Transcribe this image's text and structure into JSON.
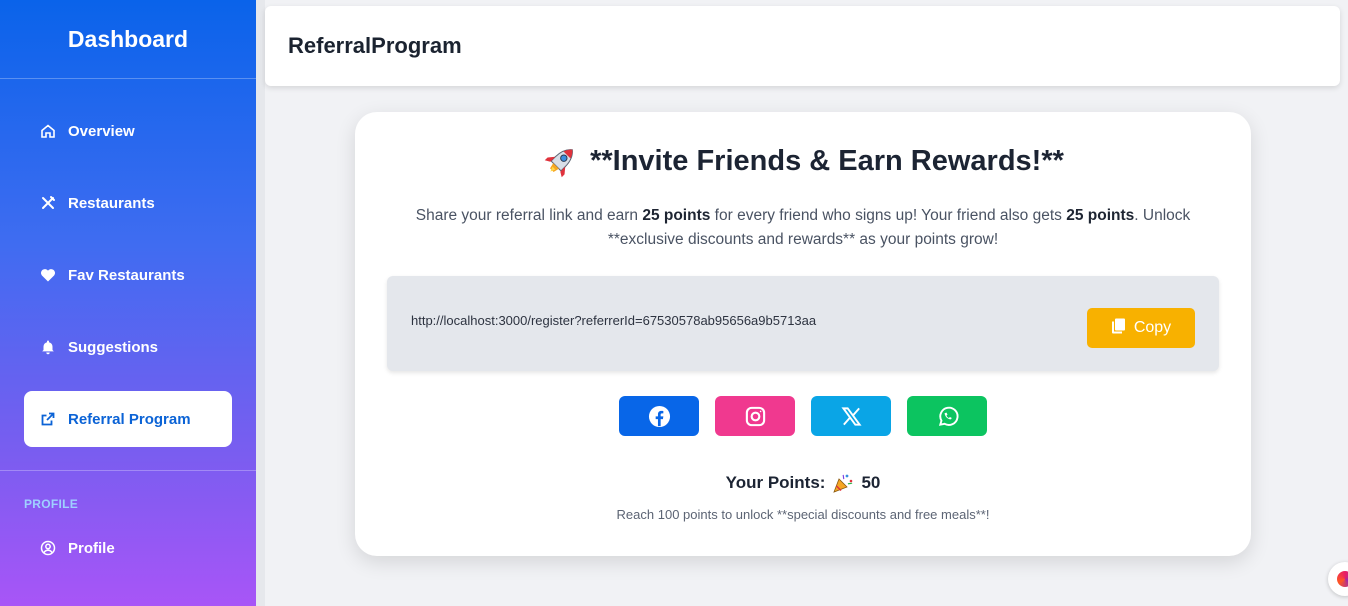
{
  "sidebar": {
    "title": "Dashboard",
    "items": [
      {
        "label": "Overview",
        "icon": "home-icon"
      },
      {
        "label": "Restaurants",
        "icon": "utensils-icon"
      },
      {
        "label": "Fav Restaurants",
        "icon": "heart-icon"
      },
      {
        "label": "Suggestions",
        "icon": "bell-icon"
      },
      {
        "label": "Referral Program",
        "icon": "share-icon",
        "active": true
      }
    ],
    "section_label": "PROFILE",
    "profile_item": {
      "label": "Profile",
      "icon": "user-circle-icon"
    }
  },
  "header": {
    "title": "ReferralProgram"
  },
  "card": {
    "title": "**Invite Friends & Earn Rewards!**",
    "desc_part1": "Share your referral link and earn ",
    "desc_bold1": "25 points",
    "desc_part2": " for every friend who signs up! Your friend also gets ",
    "desc_bold2": "25 points",
    "desc_part3": ". Unlock **exclusive discounts and rewards** as your points grow!",
    "referral_link": "http://localhost:3000/register?referrerId=67530578ab95656a9b5713aa",
    "copy_label": "Copy",
    "share_buttons": [
      {
        "name": "facebook",
        "icon": "facebook-icon",
        "color": "#0866e8"
      },
      {
        "name": "instagram",
        "icon": "instagram-icon",
        "color": "#f0398f"
      },
      {
        "name": "x",
        "icon": "x-icon",
        "color": "#0aa5e6"
      },
      {
        "name": "whatsapp",
        "icon": "whatsapp-icon",
        "color": "#0cc460"
      }
    ],
    "points_label": "Your Points:",
    "points_value": "50",
    "points_note": "Reach 100 points to unlock **special discounts and free meals**!"
  },
  "colors": {
    "accent": "#0b63d6",
    "copy_button": "#f8b100"
  }
}
